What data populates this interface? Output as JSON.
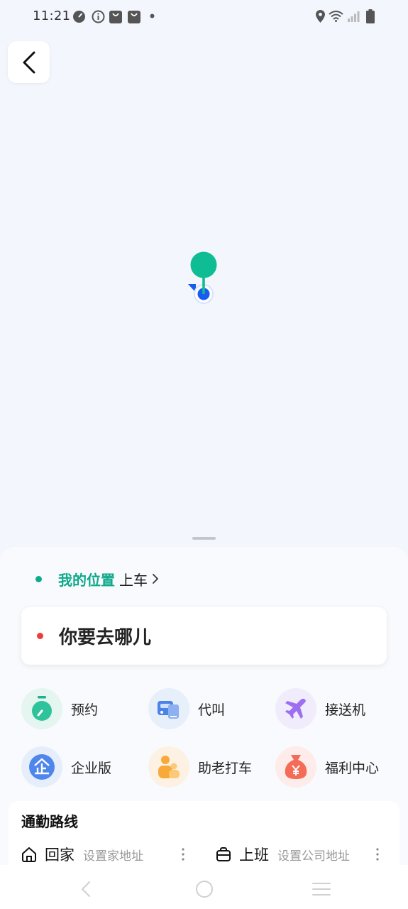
{
  "status_bar": {
    "time": "11:21",
    "left_icons": [
      "speedometer-icon",
      "info-icon",
      "shopping-bag-icon",
      "shopping-bag-icon",
      "dot-icon"
    ],
    "right_icons": [
      "location-icon",
      "wifi-icon",
      "signal-icon",
      "battery-icon"
    ]
  },
  "map": {
    "back_icon": "back-arrow-icon",
    "pin_color": "#0fbd94",
    "location_color": "#1a5cf0"
  },
  "pickup": {
    "location": "我的位置",
    "action": "上车"
  },
  "destination": {
    "placeholder": "你要去哪儿"
  },
  "services": [
    {
      "label": "预约",
      "icon": "stopwatch-icon"
    },
    {
      "label": "代叫",
      "icon": "car-phone-icon"
    },
    {
      "label": "接送机",
      "icon": "airplane-icon"
    },
    {
      "label": "企业版",
      "icon": "enterprise-icon"
    },
    {
      "label": "助老打车",
      "icon": "elderly-icon"
    },
    {
      "label": "福利中心",
      "icon": "money-bag-icon"
    }
  ],
  "commute": {
    "title": "通勤路线",
    "home_label": "回家",
    "home_hint": "设置家地址",
    "work_label": "上班",
    "work_hint": "设置公司地址"
  },
  "colors": {
    "accent_green": "#0fa98b",
    "dest_dot_red": "#ef3b3b",
    "background": "#f3f6fd"
  },
  "nav_bar": [
    "back-icon",
    "home-icon",
    "menu-icon"
  ]
}
